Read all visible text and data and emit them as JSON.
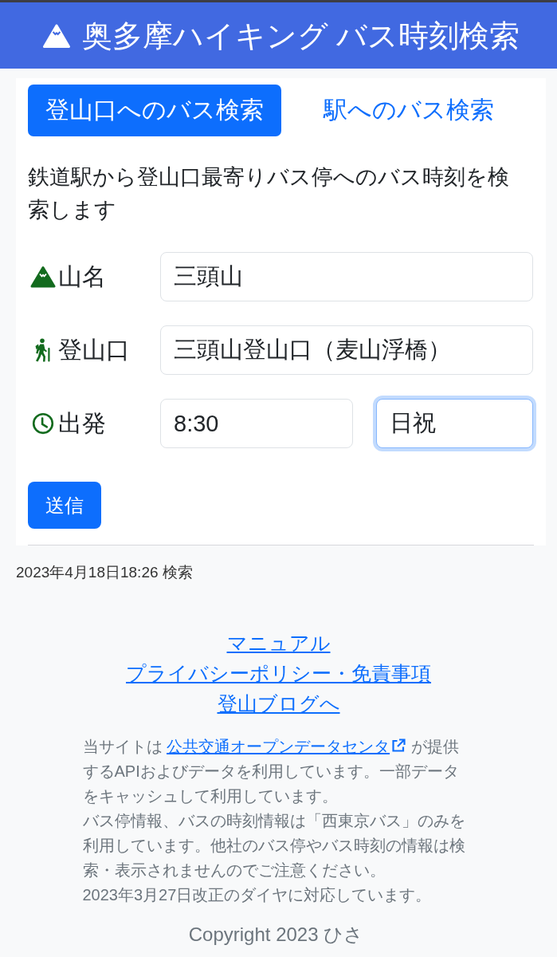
{
  "header": {
    "title": "奥多摩ハイキング バス時刻検索"
  },
  "tabs": [
    {
      "label": "登山口へのバス検索",
      "selected": true
    },
    {
      "label": "駅へのバス検索",
      "selected": false
    }
  ],
  "description": "鉄道駅から登山口最寄りバス停へのバス時刻を検索します",
  "form": {
    "fields": [
      {
        "kind": "mountain",
        "label": "山名",
        "inputs": [
          {
            "value": "三頭山",
            "focused": false
          }
        ]
      },
      {
        "kind": "trailhead",
        "label": "登山口",
        "inputs": [
          {
            "value": "三頭山登山口（麦山浮橋）",
            "focused": false
          }
        ]
      },
      {
        "kind": "departure",
        "label": "出発",
        "inputs": [
          {
            "value": "8:30",
            "focused": false
          },
          {
            "value": "日祝",
            "focused": true
          }
        ]
      }
    ],
    "submit": "送信"
  },
  "search_time": "2023年4月18日18:26 検索",
  "footer": {
    "links": [
      "マニュアル",
      "プライバシーポリシー・免責事項",
      "登山ブログへ"
    ],
    "notes": [
      {
        "parts": [
          {
            "kind": "text",
            "text": "当サイトは"
          },
          {
            "kind": "link",
            "text": "公共交通オープンデータセンタ",
            "external": true
          },
          {
            "kind": "text",
            "text": "が提供するAPIおよびデータを利用しています。一部データをキャッシュして利用しています。"
          }
        ]
      },
      {
        "parts": [
          {
            "kind": "text",
            "text": "バス停情報、バスの時刻情報は「西東京バス」のみを利用しています。他社のバス停やバス時刻の情報は検索・表示されませんのでご注意ください。"
          }
        ]
      },
      {
        "parts": [
          {
            "kind": "text",
            "text": "2023年3月27日改正のダイヤに対応しています。"
          }
        ]
      }
    ],
    "copyright": "Copyright 2023 ひさ"
  }
}
